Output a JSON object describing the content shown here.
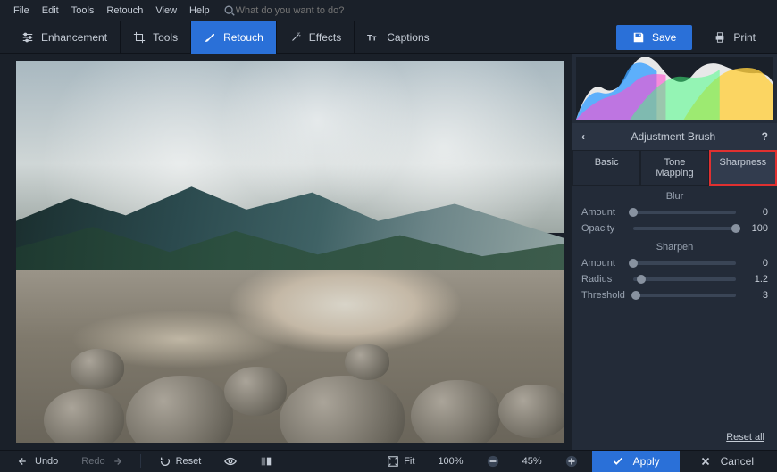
{
  "menubar": {
    "items": [
      "File",
      "Edit",
      "Tools",
      "Retouch",
      "View",
      "Help"
    ],
    "search_placeholder": "What do you want to do?"
  },
  "toolbar": {
    "tabs": [
      {
        "label": "Enhancement"
      },
      {
        "label": "Tools"
      },
      {
        "label": "Retouch",
        "active": true
      },
      {
        "label": "Effects"
      },
      {
        "label": "Captions"
      }
    ],
    "save_label": "Save",
    "print_label": "Print"
  },
  "sidebar": {
    "panel_title": "Adjustment Brush",
    "sub_tabs": [
      {
        "label": "Basic"
      },
      {
        "label": "Tone Mapping"
      },
      {
        "label": "Sharpness",
        "highlighted": true
      }
    ],
    "sections": {
      "blur": {
        "title": "Blur",
        "sliders": [
          {
            "label": "Amount",
            "value": "0",
            "pos": 0
          },
          {
            "label": "Opacity",
            "value": "100",
            "pos": 100
          }
        ]
      },
      "sharpen": {
        "title": "Sharpen",
        "sliders": [
          {
            "label": "Amount",
            "value": "0",
            "pos": 0
          },
          {
            "label": "Radius",
            "value": "1.2",
            "pos": 8
          },
          {
            "label": "Threshold",
            "value": "3",
            "pos": 3
          }
        ]
      }
    },
    "reset_all_label": "Reset all"
  },
  "bottombar": {
    "undo_label": "Undo",
    "redo_label": "Redo",
    "reset_label": "Reset",
    "fit_label": "Fit",
    "zoom_label": "100%",
    "zoom_slider_label": "45%",
    "apply_label": "Apply",
    "cancel_label": "Cancel"
  }
}
